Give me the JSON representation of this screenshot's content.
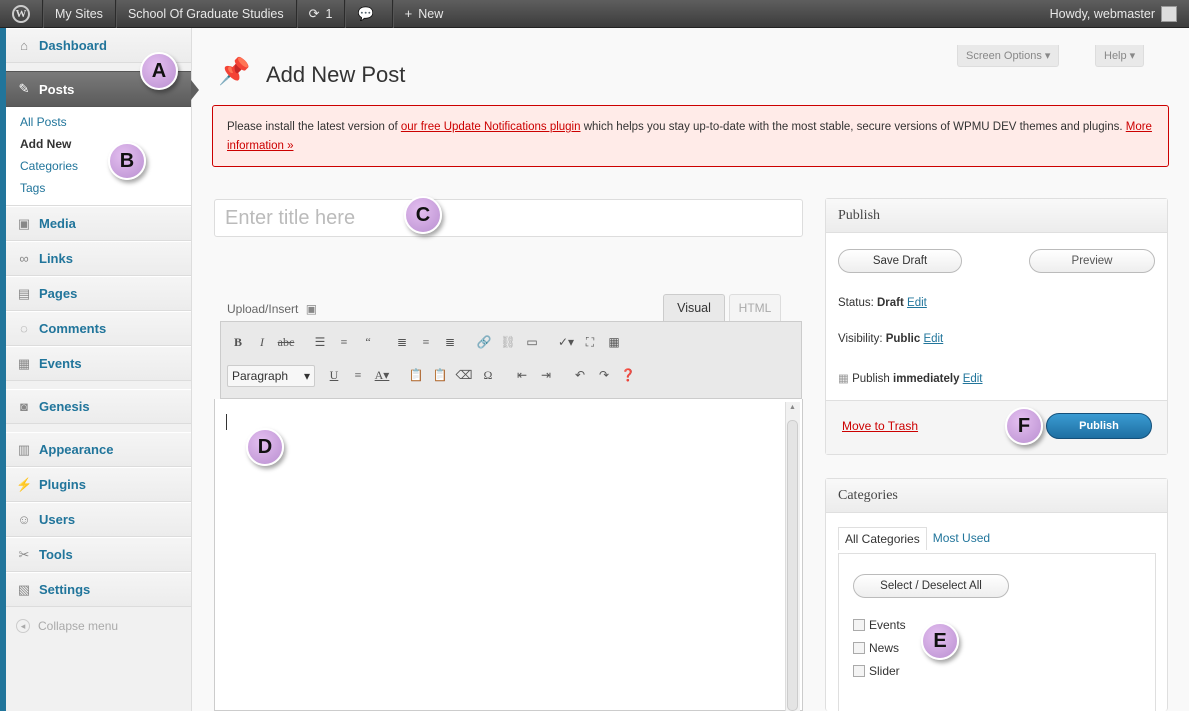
{
  "adminbar": {
    "my_sites": "My Sites",
    "site_name": "School Of Graduate Studies",
    "updates_count": "1",
    "new_label": "New",
    "howdy": "Howdy, webmaster"
  },
  "sidebar": {
    "dashboard": "Dashboard",
    "posts": "Posts",
    "posts_sub": [
      "All Posts",
      "Add New",
      "Categories",
      "Tags"
    ],
    "media": "Media",
    "links": "Links",
    "pages": "Pages",
    "comments": "Comments",
    "events": "Events",
    "genesis": "Genesis",
    "appearance": "Appearance",
    "plugins": "Plugins",
    "users": "Users",
    "tools": "Tools",
    "settings": "Settings",
    "collapse": "Collapse menu"
  },
  "header": {
    "screen_options": "Screen Options ▾",
    "help": "Help ▾",
    "title": "Add New Post"
  },
  "notice": {
    "text_before": "Please install the latest version of ",
    "link1": "our free Update Notifications plugin",
    "text_middle": " which helps you stay up-to-date with the most stable, secure versions of WPMU DEV themes and plugins. ",
    "link2": "More information »"
  },
  "editor": {
    "title_placeholder": "Enter title here",
    "upload_insert": "Upload/Insert",
    "tab_visual": "Visual",
    "tab_html": "HTML",
    "format_select": "Paragraph"
  },
  "publish": {
    "heading": "Publish",
    "save_draft": "Save Draft",
    "preview": "Preview",
    "status_label": "Status: ",
    "status_value": "Draft",
    "visibility_label": "Visibility: ",
    "visibility_value": "Public",
    "publish_label": "Publish ",
    "publish_value": "immediately",
    "edit": "Edit",
    "move_trash": "Move to Trash",
    "publish_button": "Publish"
  },
  "categories": {
    "heading": "Categories",
    "tab_all": "All Categories",
    "tab_most_used": "Most Used",
    "select_all": "Select / Deselect All",
    "items": [
      "Events",
      "News",
      "Slider"
    ]
  },
  "callouts": [
    "A",
    "B",
    "C",
    "D",
    "E",
    "F"
  ],
  "colors": {
    "accent": "#21759b",
    "publish_button": "#2a82bd",
    "notice_border": "#cc0000",
    "callout": "#c9a0dc"
  }
}
